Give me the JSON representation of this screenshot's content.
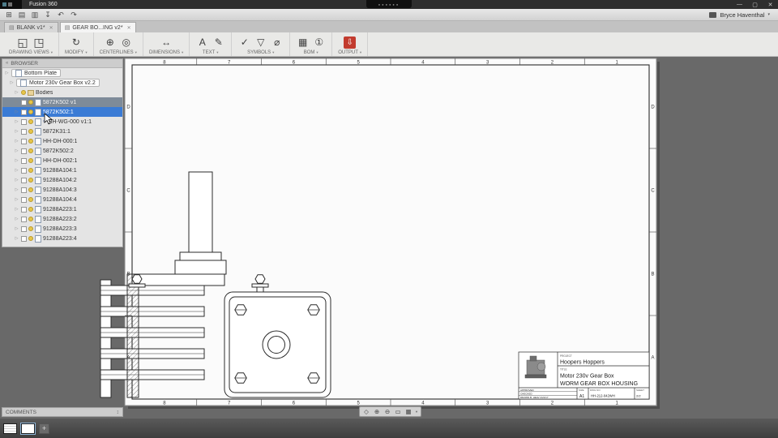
{
  "colors": {
    "selection_blue": "#3a7bd5",
    "canvas_gray": "#696969",
    "bulb_yellow": "#e7c64b",
    "output_red": "#c23b2e"
  },
  "titlebar": {
    "app": "Fusion 360",
    "badge_dots": "●●●●●●",
    "minimize": "—",
    "maximize": "▢",
    "close": "✕"
  },
  "menubar": {
    "icons": [
      {
        "name": "app-grid-icon",
        "glyph": "⊞"
      },
      {
        "name": "new-design-icon",
        "glyph": "▤"
      },
      {
        "name": "open-icon",
        "glyph": "▥"
      },
      {
        "name": "save-icon",
        "glyph": "↧"
      },
      {
        "name": "undo-icon",
        "glyph": "↶"
      },
      {
        "name": "redo-icon",
        "glyph": "↷"
      }
    ],
    "user": "Bryce Haventhal"
  },
  "icons": {
    "tab_doc": "▤",
    "close": "✕",
    "chevron": "▾",
    "arrow": "▷",
    "link": "∞",
    "collapse": "«",
    "expand": "↕"
  },
  "tabs": [
    {
      "label": "BLANK v1*",
      "active": false
    },
    {
      "label": "GEAR BO...ING v2*",
      "active": true
    }
  ],
  "ribbon": {
    "groups": [
      {
        "label": "DRAWING VIEWS",
        "icons": [
          {
            "name": "base-view-icon",
            "glyph": "◱"
          },
          {
            "name": "projected-view-icon",
            "glyph": "◳"
          }
        ]
      },
      {
        "label": "MODIFY",
        "icons": [
          {
            "name": "move-view-icon",
            "glyph": "↻"
          }
        ]
      },
      {
        "label": "CENTERLINES",
        "icons": [
          {
            "name": "centerline-icon",
            "glyph": "⊕"
          },
          {
            "name": "center-mark-icon",
            "glyph": "◎"
          }
        ]
      },
      {
        "label": "DIMENSIONS",
        "icons": [
          {
            "name": "dimension-icon",
            "glyph": "↔"
          }
        ]
      },
      {
        "label": "TEXT",
        "icons": [
          {
            "name": "text-icon",
            "glyph": "A"
          },
          {
            "name": "leader-text-icon",
            "glyph": "✎"
          }
        ]
      },
      {
        "label": "SYMBOLS",
        "icons": [
          {
            "name": "surface-texture-icon",
            "glyph": "✓"
          },
          {
            "name": "weld-symbol-icon",
            "glyph": "▽"
          },
          {
            "name": "datum-identifier-icon",
            "glyph": "⌀"
          }
        ]
      },
      {
        "label": "BOM",
        "icons": [
          {
            "name": "table-icon",
            "glyph": "▦"
          },
          {
            "name": "balloon-icon",
            "glyph": "①"
          }
        ]
      },
      {
        "label": "OUTPUT",
        "icons": [
          {
            "name": "output-pdf-icon",
            "glyph": "⇩",
            "red": true
          }
        ]
      }
    ]
  },
  "browser": {
    "header": "BROWSER",
    "items": [
      {
        "label": "Bottom Plate",
        "chip": true,
        "icon": "doc",
        "indent": 0
      },
      {
        "label": "Motor 230v Gear Box v2.2",
        "chip": true,
        "icon": "doc",
        "indent": 1
      },
      {
        "label": "Bodies",
        "icon": "folder",
        "bulb": true,
        "indent": 2
      },
      {
        "label": "5872K502 v1",
        "icon": "doc",
        "checkbox": true,
        "bulb": true,
        "highlighted": true,
        "indent": 2
      },
      {
        "label": "5872K502:1",
        "icon": "doc",
        "checkbox": true,
        "bulb": true,
        "selected": true,
        "indent": 2
      },
      {
        "label": "HH-WG-000 v1:1",
        "icon": "doc",
        "checkbox": true,
        "bulb": true,
        "link": true,
        "indent": 2
      },
      {
        "label": "5872K31:1",
        "icon": "doc",
        "checkbox": true,
        "bulb": true,
        "indent": 2
      },
      {
        "label": "HH-DH-000:1",
        "icon": "doc",
        "checkbox": true,
        "bulb": true,
        "indent": 2
      },
      {
        "label": "5872K502:2",
        "icon": "doc",
        "checkbox": true,
        "bulb": true,
        "indent": 2
      },
      {
        "label": "HH-DH-002:1",
        "icon": "doc",
        "checkbox": true,
        "bulb": true,
        "indent": 2
      },
      {
        "label": "91288A104:1",
        "icon": "doc",
        "checkbox": true,
        "bulb": true,
        "indent": 2
      },
      {
        "label": "91288A104:2",
        "icon": "doc",
        "checkbox": true,
        "bulb": true,
        "indent": 2
      },
      {
        "label": "91288A104:3",
        "icon": "doc",
        "checkbox": true,
        "bulb": true,
        "indent": 2
      },
      {
        "label": "91288A104:4",
        "icon": "doc",
        "checkbox": true,
        "bulb": true,
        "indent": 2
      },
      {
        "label": "91288A223:1",
        "icon": "doc",
        "checkbox": true,
        "bulb": true,
        "indent": 2
      },
      {
        "label": "91288A223:2",
        "icon": "doc",
        "checkbox": true,
        "bulb": true,
        "indent": 2
      },
      {
        "label": "91288A223:3",
        "icon": "doc",
        "checkbox": true,
        "bulb": true,
        "indent": 2
      },
      {
        "label": "91288A223:4",
        "icon": "doc",
        "checkbox": true,
        "bulb": true,
        "indent": 2
      }
    ]
  },
  "sheet": {
    "zone_cols": [
      "8",
      "7",
      "6",
      "5",
      "4",
      "3",
      "2",
      "1"
    ],
    "zone_rows": [
      "D",
      "C",
      "B",
      "A"
    ],
    "titleblock": {
      "project_label": "PROJECT",
      "project": "Hoopers  Hoppers",
      "title_label": "TITLE",
      "title_line1": "Motor  230v  Gear  Box",
      "title_line2": "WORM  GEAR  BOX  HOUSING",
      "approved_row": "APPROVED",
      "checked_row": "CHECKED",
      "drawn_row": "DRAWN   B. HEAV   2/21/17",
      "size_label": "SIZE",
      "size_value": "A1",
      "dwg_label": "DWG NO",
      "dwg_value": "HH-212-042WH",
      "sheet_label": "SHEET",
      "sheet_value": "2/2"
    }
  },
  "comments": {
    "header": "COMMENTS"
  },
  "navbar": {
    "icons": [
      {
        "name": "pan-icon",
        "glyph": "◇"
      },
      {
        "name": "zoom-in-icon",
        "glyph": "⊕"
      },
      {
        "name": "zoom-out-icon",
        "glyph": "⊖"
      },
      {
        "name": "zoom-window-icon",
        "glyph": "▭"
      },
      {
        "name": "display-settings-icon",
        "glyph": "▦"
      }
    ]
  },
  "bottombar": {
    "add_sheet": "+"
  }
}
